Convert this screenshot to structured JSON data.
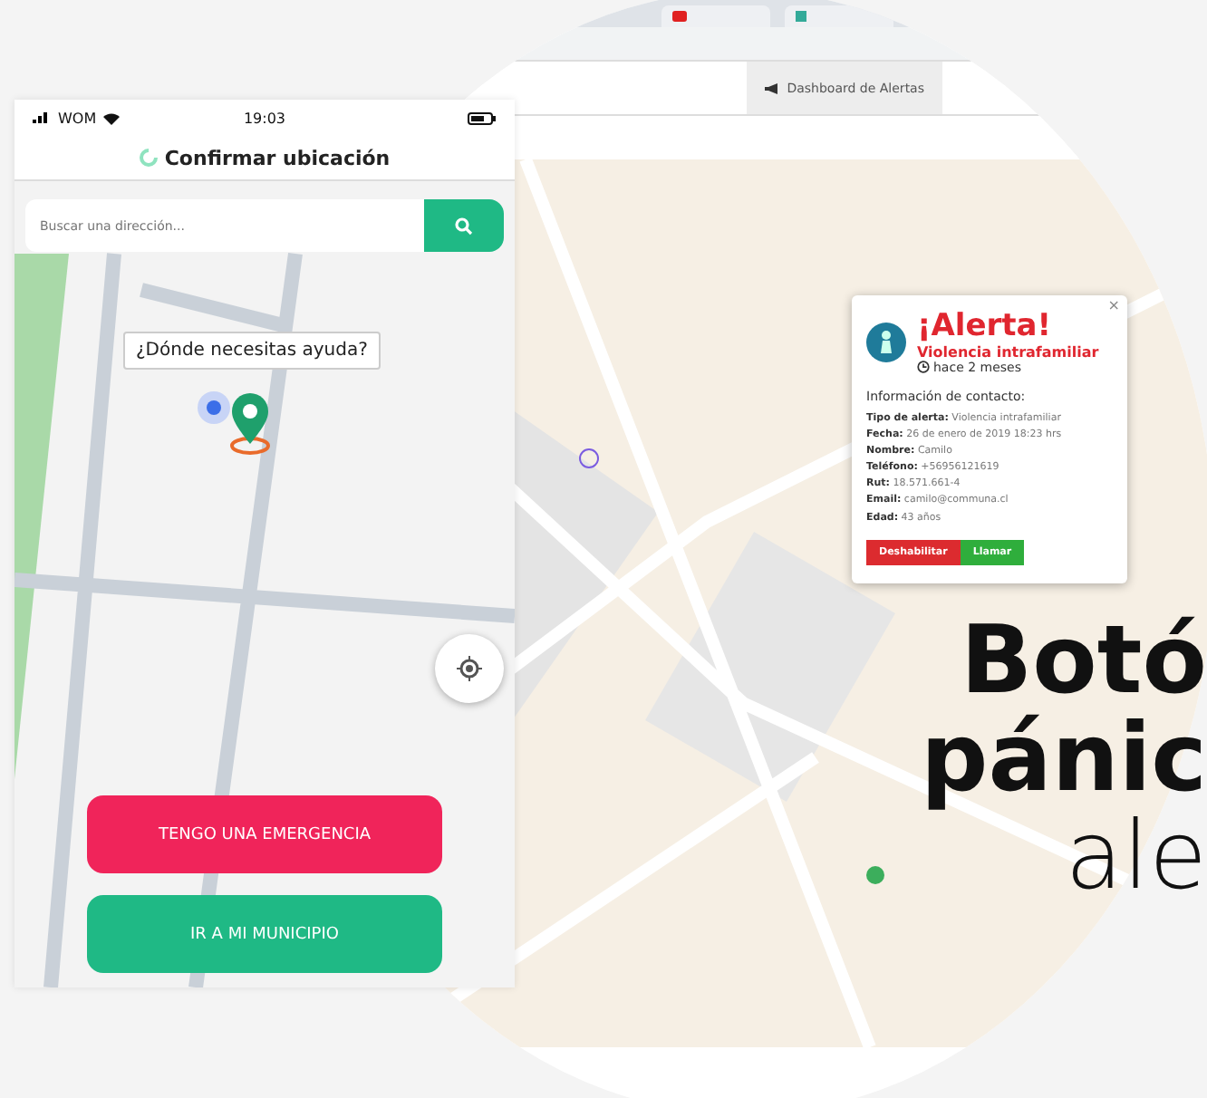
{
  "phone": {
    "status": {
      "carrier": "WOM",
      "time": "19:03"
    },
    "title": "Confirmar ubicación",
    "search": {
      "placeholder": "Buscar una dirección..."
    },
    "tooltip": "¿Dónde necesitas ayuda?",
    "buttons": [
      {
        "label": "TENGO UNA EMERGENCIA",
        "kind": "emergency"
      },
      {
        "label": "IR A MI MUNICIPIO",
        "kind": "municipio"
      }
    ]
  },
  "browser": {
    "header_button": "Dashboard de Alertas",
    "alert": {
      "close": "×",
      "title": "¡Alerta!",
      "type": "Violencia intrafamiliar",
      "time": "hace 2 meses",
      "section": "Información de contacto:",
      "fields": [
        "**Tipo de alerta:** Violencia intrafamiliar",
        "**Fecha:** 26 de enero de 2019 18:23 hrs",
        "**Nombre:** Camilo",
        "**Teléfono:** +56956121619",
        "**Rut:** 18.571.661-4",
        "**Email:** camilo@communa.cl",
        "**Edad:** 43 años"
      ],
      "actions": [
        {
          "label": "Deshabilitar",
          "kind": "danger"
        },
        {
          "label": "Llamar",
          "kind": "success"
        }
      ]
    }
  },
  "headline": [
    {
      "text": "Botó",
      "kind": "bold"
    },
    {
      "text": "pánic",
      "kind": "bold"
    },
    {
      "text": "ale",
      "kind": "light"
    }
  ]
}
